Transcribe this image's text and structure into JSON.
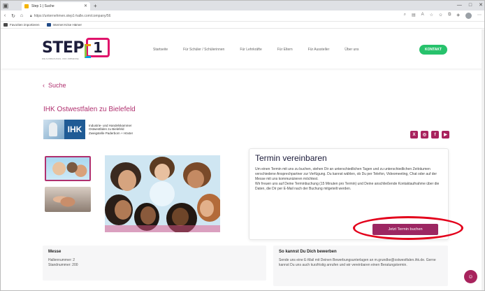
{
  "browser": {
    "tab_title": "Step 1 | Suche",
    "url": "https://unternehmen.step1-halle.com/company/56",
    "bookmarks": [
      "Favoriten importieren",
      "Internet Krise Hämer"
    ]
  },
  "site": {
    "logo": "STEP",
    "logo_number": "1",
    "logo_tagline": "DIE AUSBILDUNGS- UND JOBMESSE",
    "nav": [
      "Startseite",
      "Für Schüler / Schülerinnen",
      "Für Lehrkräfte",
      "Für Eltern",
      "Für Aussteller",
      "Über uns"
    ],
    "contact_button": "KONTAKT"
  },
  "page": {
    "back_label": "Suche",
    "company_name": "IHK Ostwestfalen zu Bielefeld",
    "ihk_logo_text": "IHK",
    "ihk_lines": [
      "Industrie- und Handelskammer",
      "Ostwestfalen zu Bielefeld",
      "Zweigstelle Paderborn + Höxter"
    ],
    "social_icons": [
      "xing-icon",
      "instagram-icon",
      "facebook-icon",
      "youtube-icon"
    ]
  },
  "termin": {
    "title": "Termin vereinbaren",
    "paragraph1": "Um einen Termin mit uns zu buchen, stehen Dir an unterschiedlichen Tagen und zu unterschiedlichen Zeiträumen verschiedene Ansprechpartner zur Verfügung. Du kannst wählen, ob Du per Telefon, Videomeeting, Chat oder auf der Messe mit uns kommunizieren möchtest.",
    "paragraph2": "Wir freuen uns auf Deine Terminbuchung (15 Minuten pro Termin) und Deine anschließende Kontaktaufnahme über die Daten, die Dir per E-Mail nach der Buchung mitgeteilt werden.",
    "button": "Jetzt Termin buchen"
  },
  "messe": {
    "title": "Messe",
    "hallennummer": "Hallennummer: 2",
    "standnummer": "Standnummer: 200"
  },
  "bewerben": {
    "title": "So kannst Du Dich bewerben",
    "text": "Sende uns eine E-Mail mit Deinen Bewerbungsunterlagen an m.grundke@ostwestfalen.ihk.de. Gerne kannst Du uns auch kurzfristig anrufen und wir vereinbaren einen Beratungstermin."
  }
}
